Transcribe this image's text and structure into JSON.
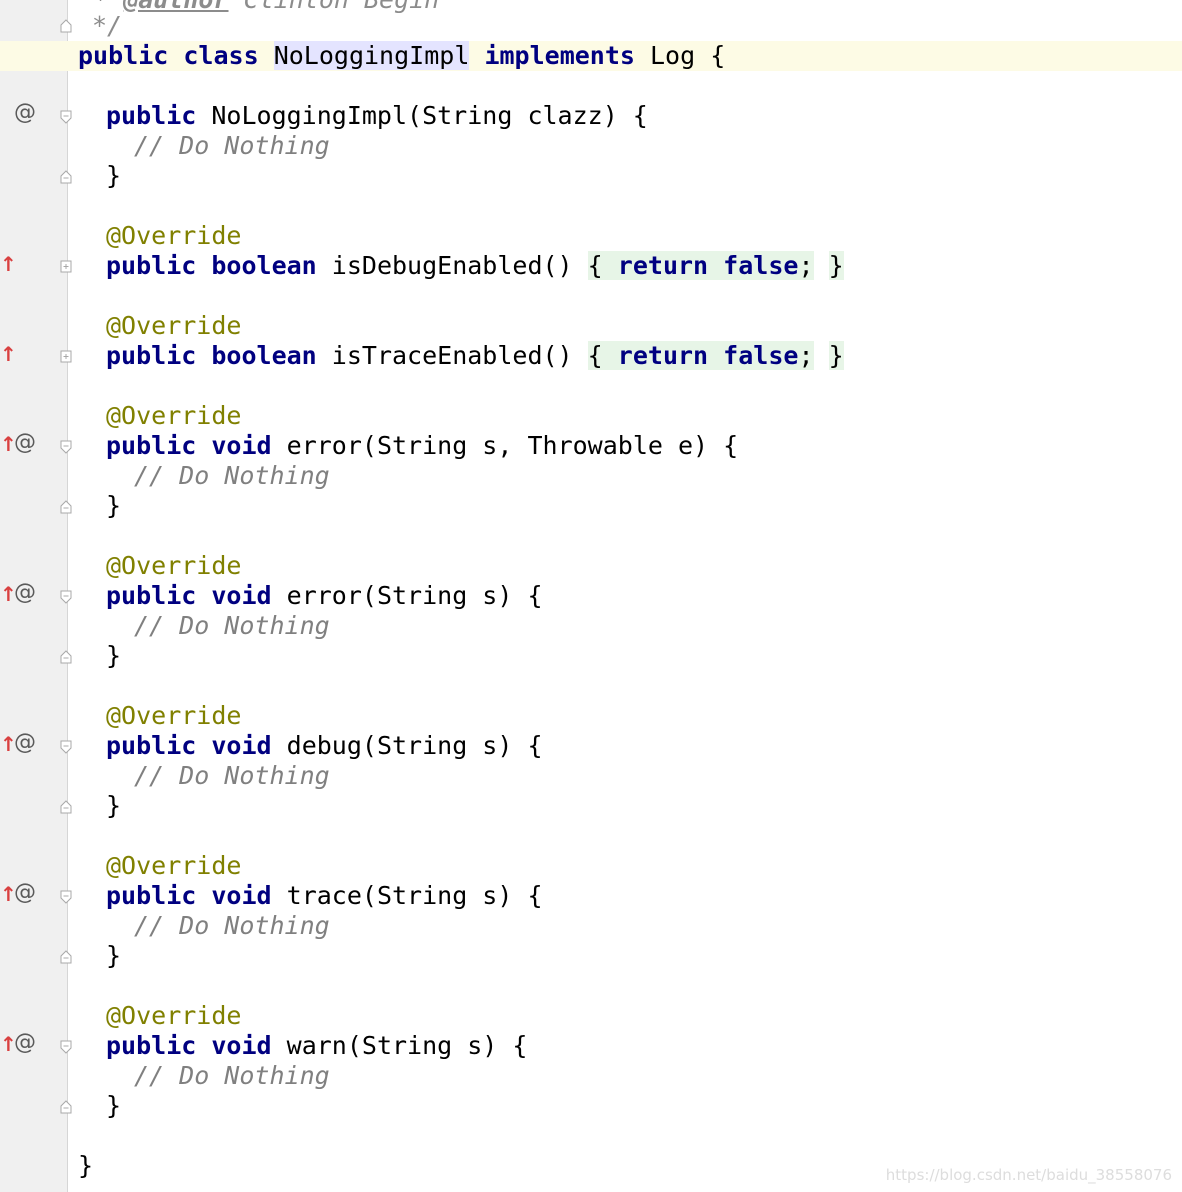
{
  "editor": {
    "doc_line_author_prefix": " * ",
    "doc_line_author_tag": "@author",
    "doc_line_author_name": " Clinton Begin",
    "doc_end": "*/",
    "class_decl": {
      "kw_public": "public",
      "kw_class": "class",
      "name": "NoLoggingImpl",
      "kw_implements": "implements",
      "rest": " Log {"
    },
    "constructor": {
      "kw_public": "public",
      "signature": " NoLoggingImpl(String clazz) {",
      "comment": "// Do Nothing",
      "close": "}"
    },
    "annotation": "@Override",
    "is_debug": {
      "kw_public": "public",
      "kw_type": "boolean",
      "name": " isDebugEnabled() ",
      "open": "{",
      "kw_return": "return",
      "kw_false": "false",
      "semi": ";",
      "close": "}"
    },
    "is_trace": {
      "kw_public": "public",
      "kw_type": "boolean",
      "name": " isTraceEnabled() ",
      "open": "{",
      "kw_return": "return",
      "kw_false": "false",
      "semi": ";",
      "close": "}"
    },
    "methods": [
      {
        "kw_public": "public",
        "kw_void": "void",
        "signature": " error(String s, Throwable e) {",
        "comment": "// Do Nothing",
        "close": "}"
      },
      {
        "kw_public": "public",
        "kw_void": "void",
        "signature": " error(String s) {",
        "comment": "// Do Nothing",
        "close": "}"
      },
      {
        "kw_public": "public",
        "kw_void": "void",
        "signature": " debug(String s) {",
        "comment": "// Do Nothing",
        "close": "}"
      },
      {
        "kw_public": "public",
        "kw_void": "void",
        "signature": " trace(String s) {",
        "comment": "// Do Nothing",
        "close": "}"
      },
      {
        "kw_public": "public",
        "kw_void": "void",
        "signature": " warn(String s) {",
        "comment": "// Do Nothing",
        "close": "}"
      }
    ],
    "class_close": "}"
  },
  "gutter": {
    "override_marker": "@",
    "implements_marker": "↑"
  },
  "watermark": "https://blog.csdn.net/baidu_38558076",
  "colors": {
    "keyword": "#000080",
    "annotation": "#808000",
    "comment": "#808080",
    "caret_row": "#fdfbe5",
    "gutter": "#f0f0f0",
    "implements_arrow": "#d94040",
    "fold_highlight": "#e7f5e7"
  }
}
